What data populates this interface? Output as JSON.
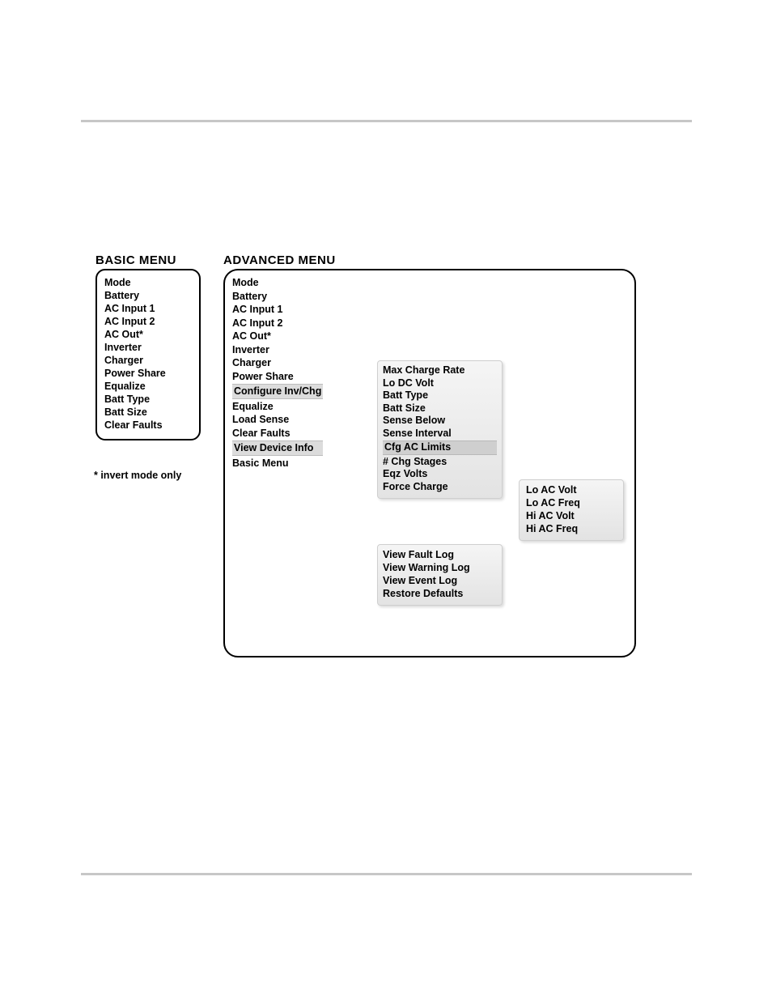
{
  "headings": {
    "basic": "BASIC MENU",
    "advanced": "ADVANCED MENU"
  },
  "footnote": "* invert mode only",
  "basic_menu": [
    "Mode",
    "Battery",
    "AC Input 1",
    "AC Input 2",
    "AC Out*",
    "Inverter",
    "Charger",
    "Power Share",
    "Equalize",
    "Batt Type",
    "Batt Size",
    "Clear Faults"
  ],
  "advanced_menu": [
    {
      "label": "Mode"
    },
    {
      "label": "Battery"
    },
    {
      "label": "AC Input 1"
    },
    {
      "label": "AC Input 2"
    },
    {
      "label": "AC Out*"
    },
    {
      "label": "Inverter"
    },
    {
      "label": "Charger"
    },
    {
      "label": "Power Share"
    },
    {
      "label": "Configure Inv/Chg",
      "link": true,
      "expands_to": "configure_submenu"
    },
    {
      "label": "Equalize"
    },
    {
      "label": "Load Sense"
    },
    {
      "label": "Clear Faults"
    },
    {
      "label": "View Device Info",
      "link": true,
      "expands_to": "device_info_submenu"
    },
    {
      "label": "Basic Menu"
    }
  ],
  "configure_submenu": [
    {
      "label": "Max Charge Rate"
    },
    {
      "label": "Lo DC Volt"
    },
    {
      "label": "Batt Type"
    },
    {
      "label": "Batt Size"
    },
    {
      "label": "Sense Below"
    },
    {
      "label": "Sense Interval"
    },
    {
      "label": "Cfg AC Limits",
      "link": true,
      "expands_to": "ac_limits_submenu"
    },
    {
      "label": "# Chg Stages"
    },
    {
      "label": "Eqz Volts"
    },
    {
      "label": "Force Charge"
    }
  ],
  "ac_limits_submenu": [
    "Lo AC Volt",
    "Lo AC Freq",
    "Hi AC Volt",
    "Hi AC Freq"
  ],
  "device_info_submenu": [
    "View Fault Log",
    "View Warning Log",
    "View Event Log",
    "Restore Defaults"
  ]
}
